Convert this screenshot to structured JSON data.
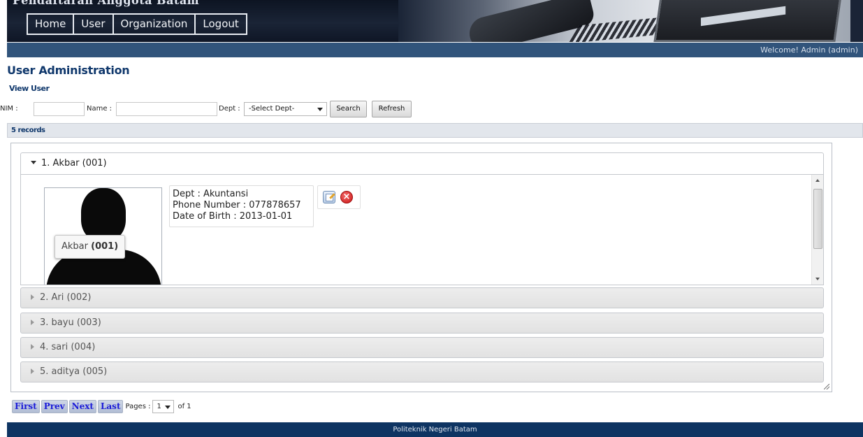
{
  "header": {
    "site_title": "Pendaftaran Anggota Batam",
    "nav": [
      "Home",
      "User",
      "Organization",
      "Logout"
    ]
  },
  "welcome": "Welcome! Admin (admin)",
  "page": {
    "title": "User Administration",
    "subtitle": "View User"
  },
  "search": {
    "nim_label": "NIM :",
    "nim_value": "",
    "name_label": "Name :",
    "name_value": "",
    "dept_label": "Dept :",
    "dept_selected": "-Select Dept-",
    "search_button": "Search",
    "refresh_button": "Refresh"
  },
  "records_label": "5 records",
  "users": [
    {
      "label": "1. Akbar (001)",
      "expanded": true
    },
    {
      "label": "2. Ari (002)",
      "expanded": false
    },
    {
      "label": "3. bayu (003)",
      "expanded": false
    },
    {
      "label": "4. sari (004)",
      "expanded": false
    },
    {
      "label": "5. aditya (005)",
      "expanded": false
    }
  ],
  "detail": {
    "tag_name": "Akbar",
    "tag_id": "(001)",
    "dept_line": "Dept : Akuntansi",
    "phone_line": "Phone Number : 077878657",
    "dob_line": "Date of Birth : 2013-01-01"
  },
  "pager": {
    "first": "First",
    "prev": "Prev",
    "next": "Next",
    "last": "Last",
    "pages_label": "Pages :",
    "current_page": "1",
    "of_label": "of 1"
  },
  "footer": "Politeknik Negeri Batam",
  "colors": {
    "header_bg": "#141c2c",
    "welcome_bar": "#31547b",
    "heading": "#10386c",
    "footer_bg": "#0e3462",
    "pager_text": "#1a1ad8"
  },
  "icons": [
    "edit-icon",
    "delete-icon"
  ]
}
